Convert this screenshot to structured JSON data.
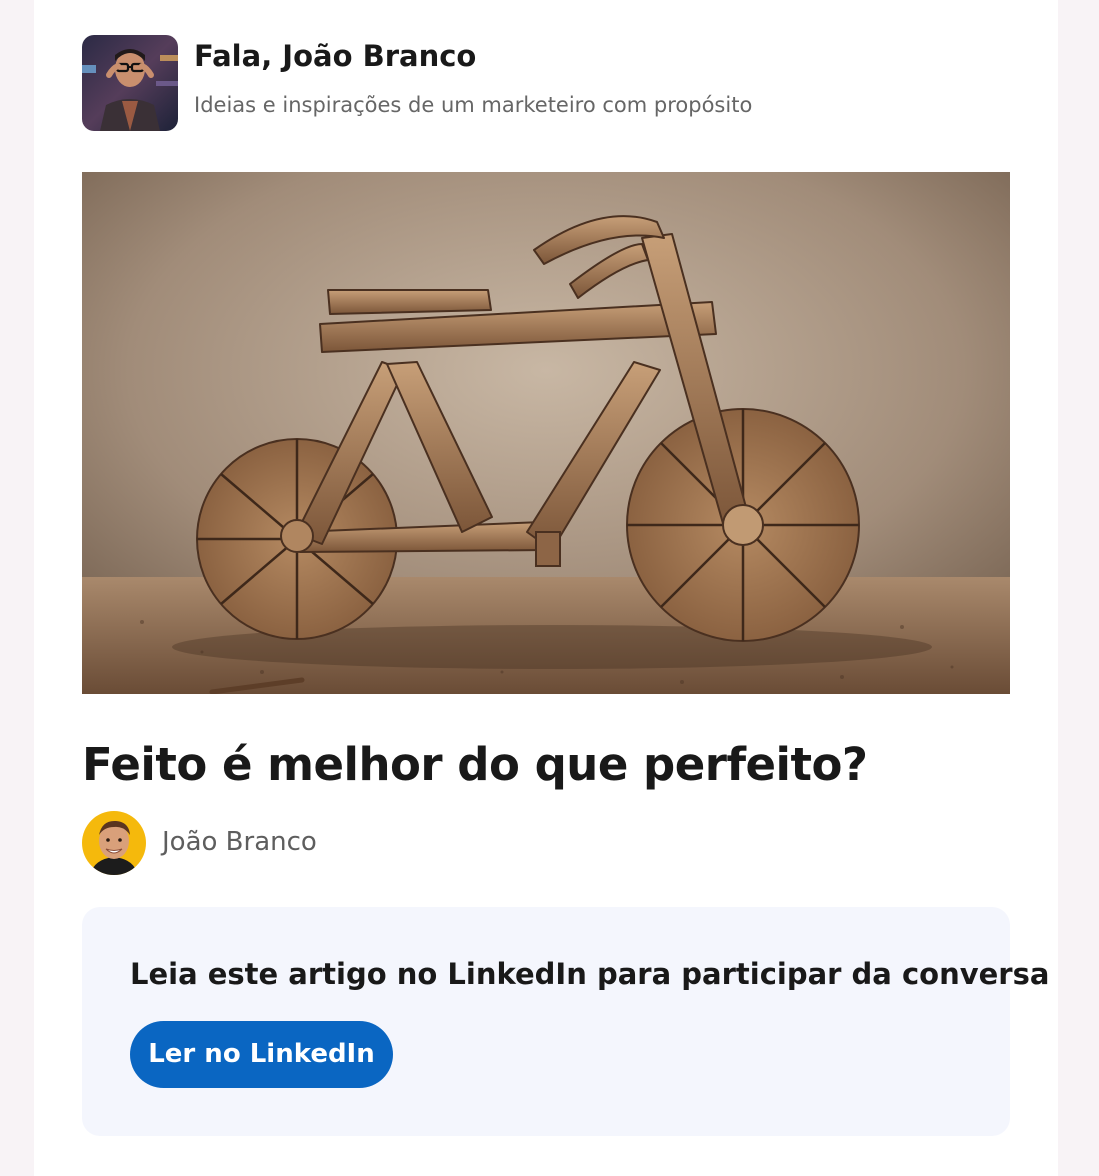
{
  "newsletter": {
    "title": "Fala, João Branco",
    "subtitle": "Ideias e inspirações de um marketeiro com propósito"
  },
  "article": {
    "title": "Feito é melhor do que perfeito?",
    "author": "João Branco"
  },
  "cta": {
    "text": "Leia este artigo no LinkedIn para participar da conversa",
    "button_label": "Ler no LinkedIn"
  },
  "colors": {
    "page_background": "#f8f3f6",
    "cta_background": "#f4f6fd",
    "button": "#0a66c2",
    "title_text": "#191919",
    "secondary_text": "#666666"
  }
}
